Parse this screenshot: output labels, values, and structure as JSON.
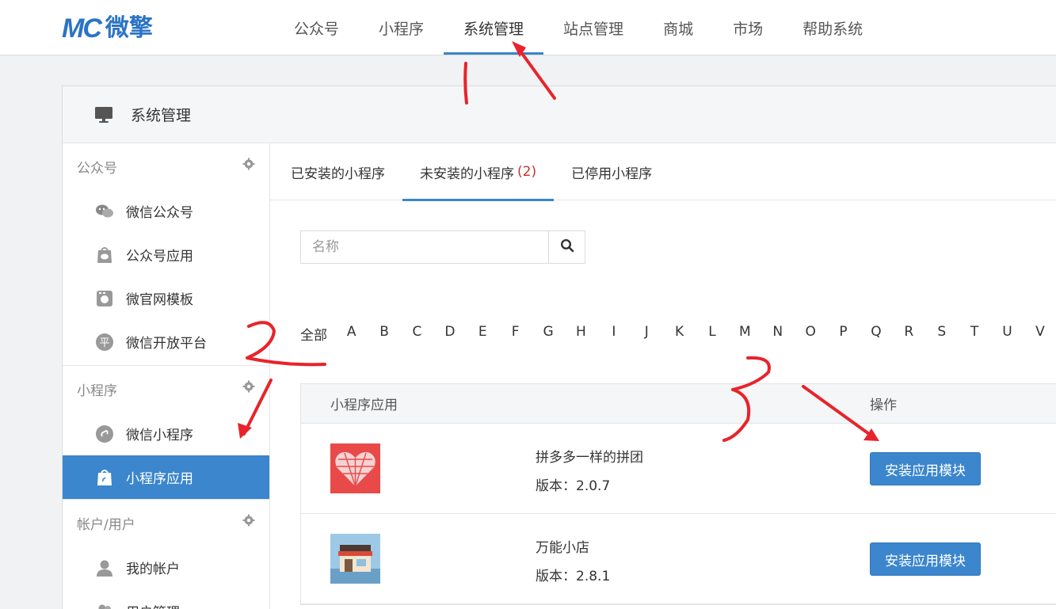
{
  "brand": {
    "mark": "MC",
    "name": "微擎"
  },
  "nav": {
    "items": [
      {
        "label": "公众号"
      },
      {
        "label": "小程序"
      },
      {
        "label": "系统管理"
      },
      {
        "label": "站点管理"
      },
      {
        "label": "商城"
      },
      {
        "label": "市场"
      },
      {
        "label": "帮助系统"
      }
    ],
    "active": "系统管理"
  },
  "panel": {
    "title": "系统管理",
    "icon": "monitor-icon"
  },
  "sidebar": {
    "groups": [
      {
        "title": "公众号",
        "items": [
          {
            "label": "微信公众号",
            "icon": "wechat-icon"
          },
          {
            "label": "公众号应用",
            "icon": "bag-icon"
          },
          {
            "label": "微官网模板",
            "icon": "template-icon"
          },
          {
            "label": "微信开放平台",
            "icon": "platform-icon"
          }
        ]
      },
      {
        "title": "小程序",
        "items": [
          {
            "label": "微信小程序",
            "icon": "miniprogram-icon"
          },
          {
            "label": "小程序应用",
            "icon": "app-bag-icon",
            "active": true
          }
        ]
      },
      {
        "title": "帐户/用户",
        "items": [
          {
            "label": "我的帐户",
            "icon": "user-icon"
          },
          {
            "label": "用户管理",
            "icon": "users-icon"
          }
        ]
      }
    ],
    "platform_glyph": "平"
  },
  "tabs": {
    "items": [
      {
        "label": "已安装的小程序"
      },
      {
        "label": "未安装的小程序",
        "count": "(2)"
      },
      {
        "label": "已停用小程序"
      }
    ],
    "active_index": 1
  },
  "search": {
    "placeholder": "名称",
    "value": ""
  },
  "letters": {
    "all_label": "全部",
    "items": [
      "A",
      "B",
      "C",
      "D",
      "E",
      "F",
      "G",
      "H",
      "I",
      "J",
      "K",
      "L",
      "M",
      "N",
      "O",
      "P",
      "Q",
      "R",
      "S",
      "T",
      "U",
      "V"
    ]
  },
  "table": {
    "headers": {
      "app": "小程序应用",
      "op": "操作"
    },
    "rows": [
      {
        "name": "拼多多一样的拼团",
        "version": "版本：2.0.7",
        "button": "安装应用模块",
        "thumb": "heart-thumb"
      },
      {
        "name": "万能小店",
        "version": "版本：2.8.1",
        "button": "安装应用模块",
        "thumb": "shop-thumb"
      }
    ]
  },
  "colors": {
    "accent": "#3b86cc",
    "count": "#c9302c",
    "annotation": "#e8232b"
  }
}
